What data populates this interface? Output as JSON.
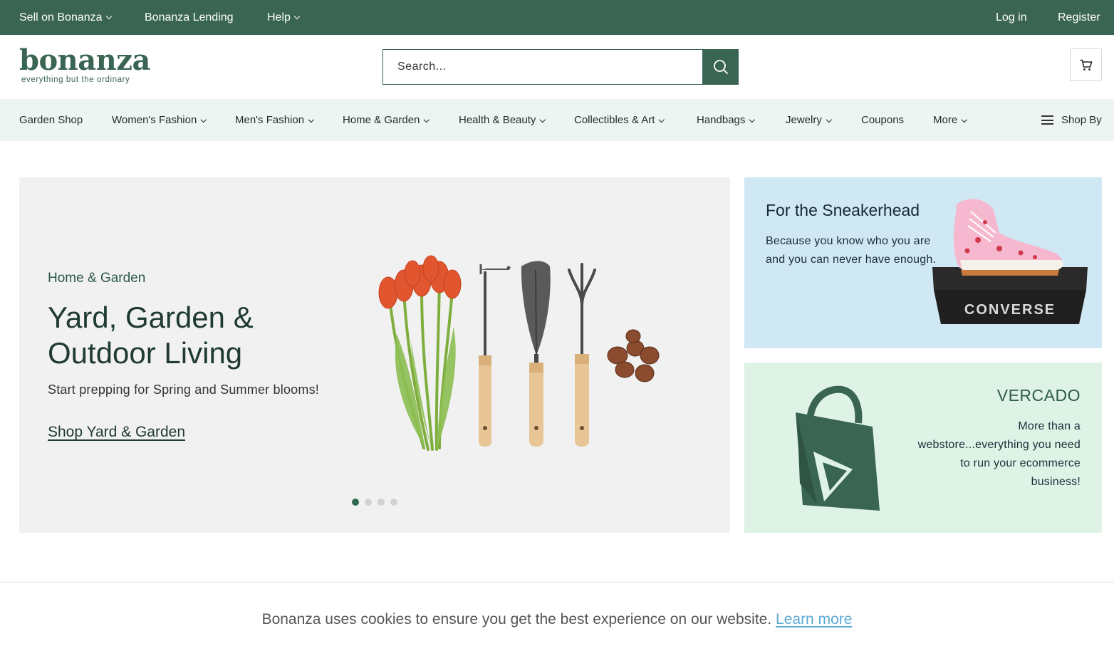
{
  "topbar": {
    "sell_label": "Sell on Bonanza",
    "lending_label": "Bonanza Lending",
    "help_label": "Help",
    "login_label": "Log in",
    "register_label": "Register"
  },
  "header": {
    "logo_text": "bonanza",
    "logo_tagline": "everything but the ordinary",
    "search_placeholder": "Search..."
  },
  "categories": [
    {
      "label": "Garden Shop",
      "dropdown": false
    },
    {
      "label": "Women's Fashion",
      "dropdown": true
    },
    {
      "label": "Men's Fashion",
      "dropdown": true
    },
    {
      "label": "Home & Garden",
      "dropdown": true
    },
    {
      "label": "Health & Beauty",
      "dropdown": true
    },
    {
      "label": "Collectibles & Art",
      "dropdown": true
    },
    {
      "label": "Handbags",
      "dropdown": true
    },
    {
      "label": "Jewelry",
      "dropdown": true
    },
    {
      "label": "Coupons",
      "dropdown": false
    },
    {
      "label": "More",
      "dropdown": true
    }
  ],
  "shop_by_label": "Shop By",
  "hero": {
    "category": "Home & Garden",
    "title": "Yard, Garden & Outdoor Living",
    "subtitle": "Start prepping for Spring and Summer blooms!",
    "link_label": "Shop Yard & Garden",
    "slide_count": 4,
    "active_slide": 1
  },
  "promo_sneakerhead": {
    "title": "For the Sneakerhead",
    "text": "Because you know who you are and you can never have enough.",
    "box_brand": "CONVERSE"
  },
  "promo_vercado": {
    "title": "VERCADO",
    "text": "More than a webstore...everything you need to run your ecommerce business!"
  },
  "cookie": {
    "text": "Bonanza uses cookies to ensure you get the best experience on our website.",
    "link_label": "Learn more"
  },
  "colors": {
    "brand_green": "#3a6553",
    "nav_bg": "#eef4f1",
    "hero_bg": "#f1f1f1",
    "sneaker_bg": "#cfe8f3",
    "vercado_bg": "#def3e6",
    "link_blue": "#5aa9d6"
  }
}
